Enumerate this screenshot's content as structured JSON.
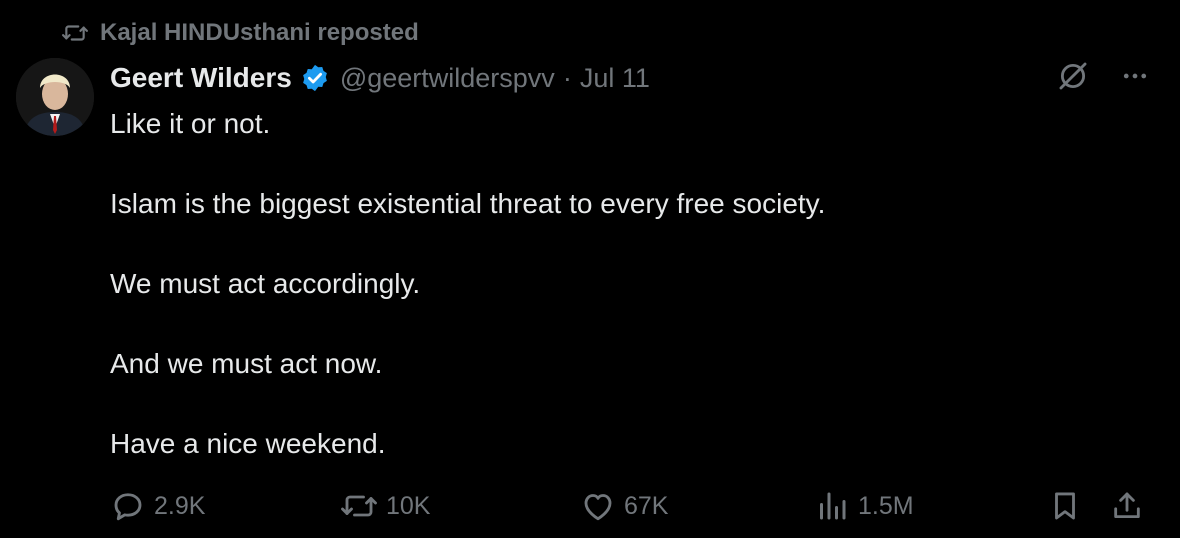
{
  "repost": {
    "text": "Kajal HINDUsthani reposted"
  },
  "author": {
    "name": "Geert Wilders",
    "handle": "@geertwilderspvv",
    "separator": "·",
    "date": "Jul 11",
    "verified_color": "#1d9bf0"
  },
  "tweet": {
    "lines": [
      "Like it or not.",
      "Islam is the biggest existential threat to every free society.",
      "We must act accordingly.",
      "And we must act now.",
      "Have a nice weekend."
    ]
  },
  "actions": {
    "replies": "2.9K",
    "reposts": "10K",
    "likes": "67K",
    "views": "1.5M"
  },
  "icons": {
    "repost": "repost-icon",
    "verified": "verified-badge-icon",
    "grok": "grok-icon",
    "more": "more-icon",
    "reply": "reply-icon",
    "like": "heart-icon",
    "views": "views-icon",
    "bookmark": "bookmark-icon",
    "share": "share-icon"
  },
  "colors": {
    "background": "#000000",
    "text": "#e7e9ea",
    "muted": "#71767b",
    "accent": "#1d9bf0"
  }
}
